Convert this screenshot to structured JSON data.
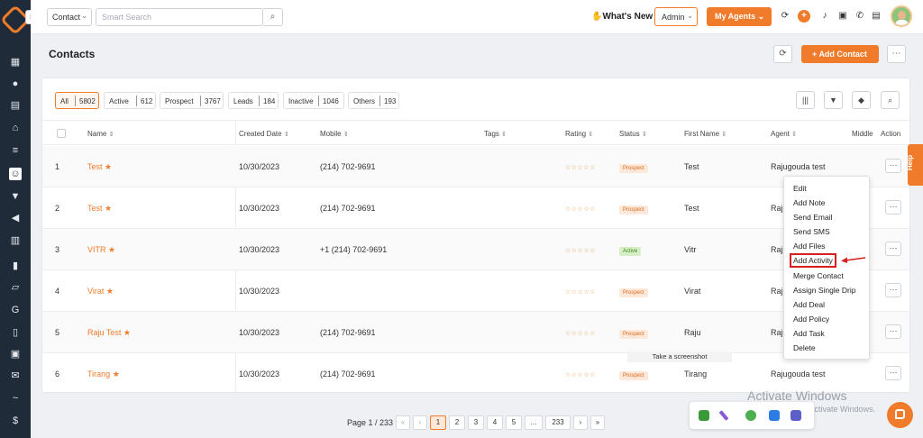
{
  "topbar": {
    "scope": "Contact",
    "search_placeholder": "Smart Search",
    "whats_new": "What's New",
    "admin": "Admin",
    "my_agents": "My Agents"
  },
  "page": {
    "title": "Contacts",
    "add_contact": "Add Contact"
  },
  "filters": [
    {
      "label": "All",
      "count": "5802"
    },
    {
      "label": "Active",
      "count": "612"
    },
    {
      "label": "Prospect",
      "count": "3767"
    },
    {
      "label": "Leads",
      "count": "184"
    },
    {
      "label": "Inactive",
      "count": "1046"
    },
    {
      "label": "Others",
      "count": "193"
    }
  ],
  "columns": {
    "name": "Name",
    "created": "Created Date",
    "mobile": "Mobile",
    "tags": "Tags",
    "rating": "Rating",
    "status": "Status",
    "first": "First Name",
    "agent": "Agent",
    "middle": "Middle",
    "action": "Action"
  },
  "rows": [
    {
      "num": "1",
      "name": "Test",
      "created": "10/30/2023",
      "mobile": "(214) 702-9691",
      "status": "Prospect",
      "first": "Test",
      "agent": "Rajugouda test"
    },
    {
      "num": "2",
      "name": "Test",
      "created": "10/30/2023",
      "mobile": "(214) 702-9691",
      "status": "Prospect",
      "first": "Test",
      "agent": "Raju"
    },
    {
      "num": "3",
      "name": "VITR",
      "created": "10/30/2023",
      "mobile": "+1 (214) 702-9691",
      "status": "Active",
      "first": "Vitr",
      "agent": "Raju"
    },
    {
      "num": "4",
      "name": "Virat",
      "created": "10/30/2023",
      "mobile": "",
      "status": "Prospect",
      "first": "Virat",
      "agent": "Raju"
    },
    {
      "num": "5",
      "name": "Raju Test",
      "created": "10/30/2023",
      "mobile": "(214) 702-9691",
      "status": "Prospect",
      "first": "Raju",
      "agent": "Raju"
    },
    {
      "num": "6",
      "name": "Tirang",
      "created": "10/30/2023",
      "mobile": "(214) 702-9691",
      "status": "Prospect",
      "first": "Tirang",
      "agent": "Rajugouda test"
    }
  ],
  "action_menu": [
    "Edit",
    "Add Note",
    "Send Email",
    "Send SMS",
    "Add Files",
    "Add Activity",
    "Merge Contact",
    "Assign Single Drip",
    "Add Deal",
    "Add Policy",
    "Add Task",
    "Delete"
  ],
  "tooltip": "Take a screenshot",
  "help": "Help",
  "pager": {
    "label": "Page 1 / 233",
    "pages": [
      "«",
      "‹",
      "1",
      "2",
      "3",
      "4",
      "5",
      "...",
      "233",
      "›",
      "»"
    ]
  },
  "watermark": {
    "title": "Activate Windows",
    "sub": "Go to Settings to activate Windows."
  },
  "colors": {
    "accent": "#f07b2a",
    "sidebar": "#1f2b38"
  }
}
